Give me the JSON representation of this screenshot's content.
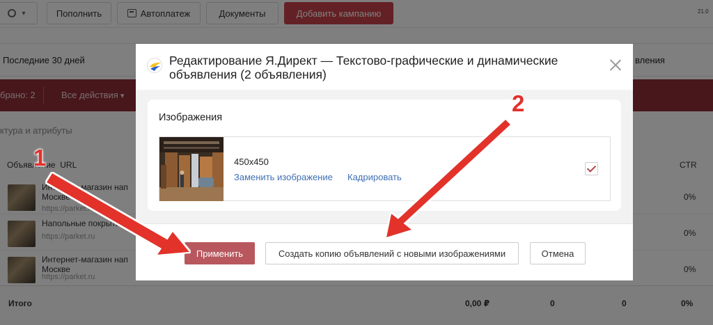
{
  "topbar": {
    "fill_label": "Пополнить",
    "autopay_label": "Автоплатеж",
    "docs_label": "Документы",
    "add_campaign_label": "Добавить кампанию",
    "date_fragment": "21.0",
    "settings_icon": "gear-icon",
    "autopay_icon": "calendar-icon"
  },
  "period": {
    "label": "Последние 30 дней",
    "right_fragment": "вления"
  },
  "selection_bar": {
    "selected": "брано: 2",
    "actions": "Все действия"
  },
  "attributes_label": "ктура и атрибуты",
  "table": {
    "headers": {
      "ad": "Объявление",
      "url": "URL",
      "ctr": "CTR"
    },
    "rows": [
      {
        "title": "Интернет-магазин нап Москве",
        "url": "https://parket.ru",
        "ctr": "0%"
      },
      {
        "title": "Напольные покрыти",
        "url": "https://parket.ru",
        "ctr": "0%"
      },
      {
        "title": "Интернет-магазин нап Москве",
        "url": "https://parket.ru",
        "ctr": "0%"
      }
    ],
    "total": {
      "label": "Итого",
      "cost": "0,00 ₽",
      "c2": "0",
      "c3": "0",
      "ctr": "0%"
    }
  },
  "modal": {
    "title": "Редактирование Я.Директ — Текстово-графические и динамические объявления (2 объявления)",
    "section_title": "Изображения",
    "image": {
      "size": "450x450",
      "replace_label": "Заменить изображение",
      "crop_label": "Кадрировать",
      "checked": true
    },
    "buttons": {
      "apply": "Применить",
      "copy": "Создать копию объявлений с новыми изображениями",
      "cancel": "Отмена"
    }
  },
  "annotations": {
    "marker_1": "1",
    "marker_2": "2",
    "color": "#e2312c"
  },
  "colors": {
    "accent_red": "#c8424a",
    "apply_button": "#b8585e",
    "selection_bar": "#8f2e36",
    "link": "#3f6fb5"
  }
}
